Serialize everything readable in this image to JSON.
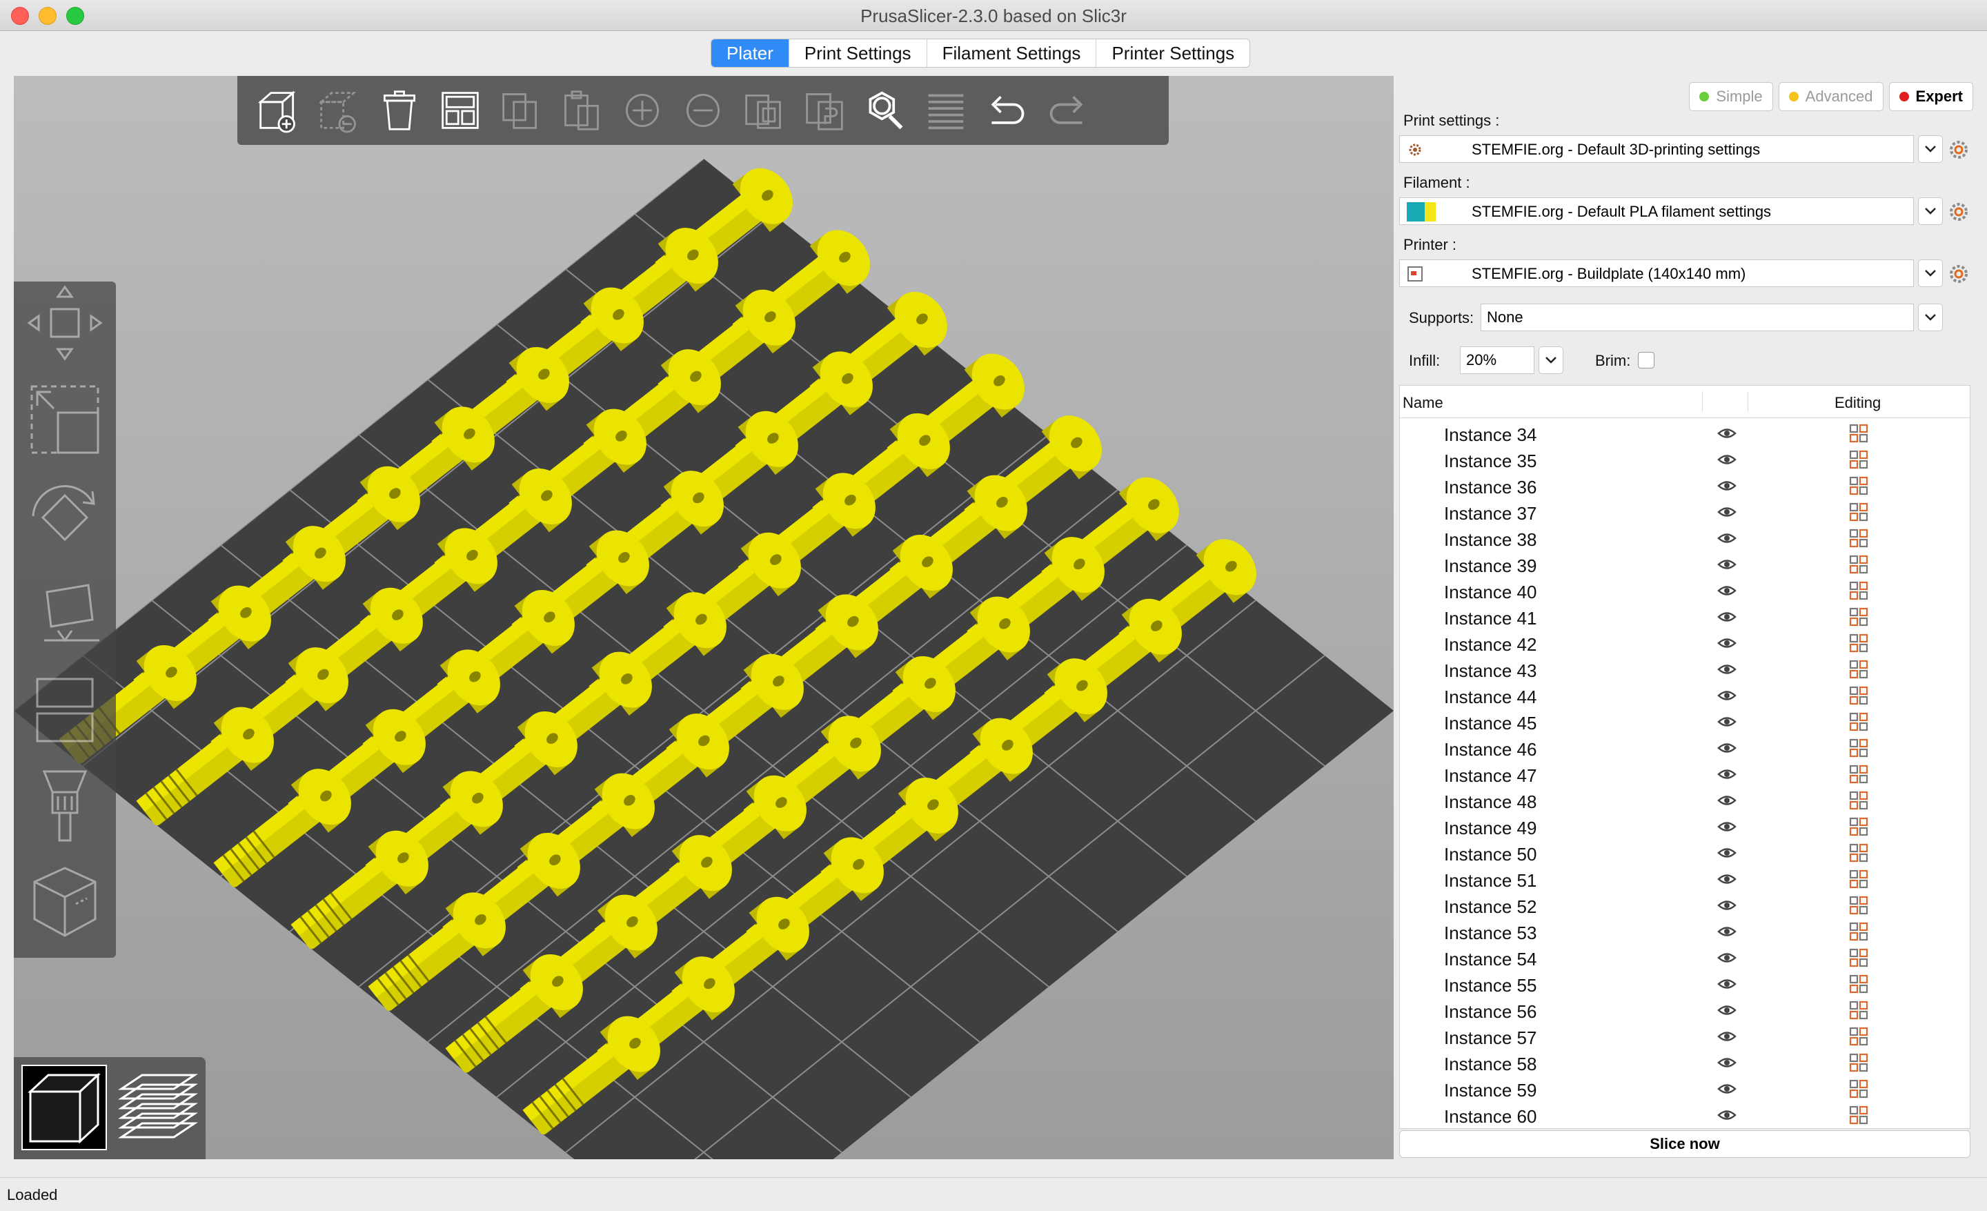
{
  "window": {
    "title": "PrusaSlicer-2.3.0 based on Slic3r"
  },
  "tabs": [
    {
      "label": "Plater",
      "active": true
    },
    {
      "label": "Print Settings",
      "active": false
    },
    {
      "label": "Filament Settings",
      "active": false
    },
    {
      "label": "Printer Settings",
      "active": false
    }
  ],
  "modes": {
    "simple": {
      "label": "Simple",
      "color": "#6acd3b"
    },
    "advanced": {
      "label": "Advanced",
      "color": "#f2c418"
    },
    "expert": {
      "label": "Expert",
      "color": "#e21d1d",
      "active": true
    }
  },
  "print_settings": {
    "label": "Print settings :",
    "value": "STEMFIE.org - Default 3D-printing settings"
  },
  "filament": {
    "label": "Filament :",
    "value": "STEMFIE.org - Default PLA filament settings",
    "swatch_color": "#19a9b5",
    "swatch_color2": "#f1e61a"
  },
  "printer": {
    "label": "Printer :",
    "value": "STEMFIE.org - Buildplate (140x140 mm)"
  },
  "supports": {
    "label": "Supports:",
    "value": "None"
  },
  "infill": {
    "label": "Infill:",
    "value": "20%"
  },
  "brim": {
    "label": "Brim:",
    "checked": false
  },
  "object_list": {
    "col_name": "Name",
    "col_editing": "Editing",
    "items": [
      "Instance 34",
      "Instance 35",
      "Instance 36",
      "Instance 37",
      "Instance 38",
      "Instance 39",
      "Instance 40",
      "Instance 41",
      "Instance 42",
      "Instance 43",
      "Instance 44",
      "Instance 45",
      "Instance 46",
      "Instance 47",
      "Instance 48",
      "Instance 49",
      "Instance 50",
      "Instance 51",
      "Instance 52",
      "Instance 53",
      "Instance 54",
      "Instance 55",
      "Instance 56",
      "Instance 57",
      "Instance 58",
      "Instance 59",
      "Instance 60"
    ]
  },
  "slice_button": {
    "label": "Slice now"
  },
  "status": {
    "text": "Loaded"
  },
  "top_toolbar": [
    {
      "name": "add-icon",
      "enabled": true
    },
    {
      "name": "delete-icon",
      "enabled": false
    },
    {
      "name": "delete-all-icon",
      "enabled": true
    },
    {
      "name": "arrange-icon",
      "enabled": true
    },
    {
      "name": "copy-icon",
      "enabled": false
    },
    {
      "name": "paste-icon",
      "enabled": false
    },
    {
      "name": "add-instance-icon",
      "enabled": false
    },
    {
      "name": "remove-instance-icon",
      "enabled": false
    },
    {
      "name": "split-objects-icon",
      "enabled": false
    },
    {
      "name": "split-parts-icon",
      "enabled": false
    },
    {
      "name": "search-icon",
      "enabled": true
    },
    {
      "name": "layers-editing-icon",
      "enabled": false
    },
    {
      "name": "undo-icon",
      "enabled": true
    },
    {
      "name": "redo-icon",
      "enabled": false
    }
  ],
  "left_toolbar": [
    "move-icon",
    "scale-icon",
    "rotate-icon",
    "place-on-face-icon",
    "cut-icon",
    "supports-paint-icon",
    "seam-paint-icon"
  ],
  "view_switch": [
    "3d-view-icon",
    "preview-icon"
  ],
  "colors": {
    "accent": "#2f8bf6",
    "model": "#e6df05",
    "bed": "#3f3f3f"
  }
}
